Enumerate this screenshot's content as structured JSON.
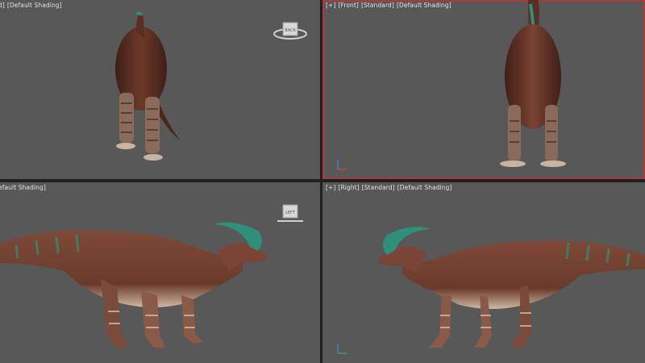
{
  "viewports": {
    "top_left": {
      "label_view": "d]",
      "label_shading": "[Default Shading]",
      "viewcube_label": "BACK"
    },
    "top_right": {
      "label_plus": "[+]",
      "label_view": "[Front]",
      "label_mode": "[Standard]",
      "label_shading": "[Default Shading]"
    },
    "bottom_left": {
      "label_shading": "efault Shading]",
      "viewcube_label": "LEFT"
    },
    "bottom_right": {
      "label_plus": "[+]",
      "label_view": "[Right]",
      "label_mode": "[Standard]",
      "label_shading": "[Default Shading]"
    }
  },
  "colors": {
    "viewport_bg": "#585858",
    "separator": "#1f1f1f",
    "active_border": "#a83b3b",
    "skin_dark": "#5a2e22",
    "skin_mid": "#7e4a38",
    "belly": "#d8c2ad",
    "crest": "#2f8f7a"
  },
  "icons": [
    "viewcube-icon",
    "axis-tripod-icon"
  ]
}
